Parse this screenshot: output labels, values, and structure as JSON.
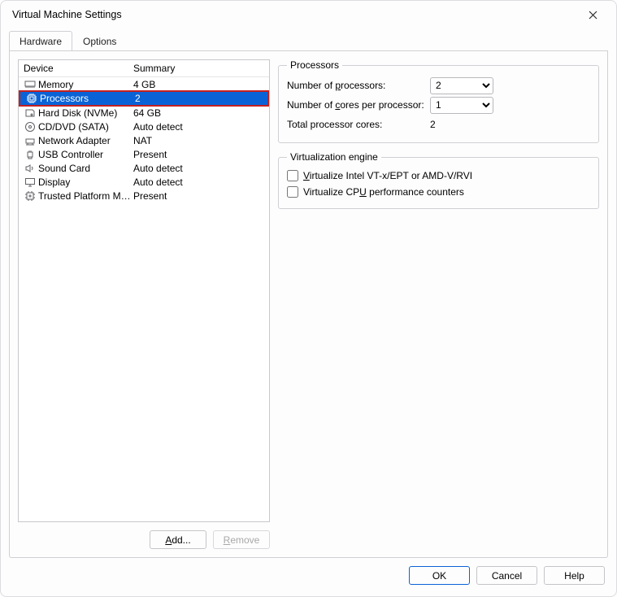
{
  "window": {
    "title": "Virtual Machine Settings"
  },
  "tabs": {
    "hardware": "Hardware",
    "options": "Options"
  },
  "devlist": {
    "col_device": "Device",
    "col_summary": "Summary",
    "items": [
      {
        "icon": "memory-icon",
        "name": "Memory",
        "summary": "4 GB"
      },
      {
        "icon": "cpu-icon",
        "name": "Processors",
        "summary": "2",
        "selected": true
      },
      {
        "icon": "disk-icon",
        "name": "Hard Disk (NVMe)",
        "summary": "64 GB"
      },
      {
        "icon": "cd-icon",
        "name": "CD/DVD (SATA)",
        "summary": "Auto detect"
      },
      {
        "icon": "network-icon",
        "name": "Network Adapter",
        "summary": "NAT"
      },
      {
        "icon": "usb-icon",
        "name": "USB Controller",
        "summary": "Present"
      },
      {
        "icon": "sound-icon",
        "name": "Sound Card",
        "summary": "Auto detect"
      },
      {
        "icon": "display-icon",
        "name": "Display",
        "summary": "Auto detect"
      },
      {
        "icon": "tpm-icon",
        "name": "Trusted Platform Mo...",
        "summary": "Present"
      }
    ]
  },
  "left_buttons": {
    "add": "Add...",
    "remove": "Remove"
  },
  "processors": {
    "legend": "Processors",
    "num_proc_label_pre": "Number of ",
    "num_proc_label_ul": "p",
    "num_proc_label_post": "rocessors:",
    "num_proc_value": "2",
    "cores_label_pre": "Number of ",
    "cores_label_ul": "c",
    "cores_label_post": "ores per processor:",
    "cores_value": "1",
    "total_label": "Total processor cores:",
    "total_value": "2"
  },
  "virt": {
    "legend": "Virtualization engine",
    "chk1_pre": "",
    "chk1_ul": "V",
    "chk1_post": "irtualize Intel VT-x/EPT or AMD-V/RVI",
    "chk2_pre": "Virtualize CP",
    "chk2_ul": "U",
    "chk2_post": " performance counters"
  },
  "footer": {
    "ok": "OK",
    "cancel": "Cancel",
    "help": "Help"
  }
}
